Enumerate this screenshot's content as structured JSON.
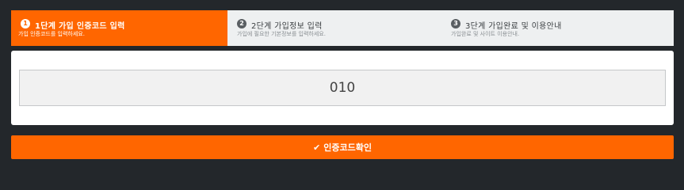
{
  "steps": [
    {
      "number": "1",
      "title": "1단계 가입 인증코드 입력",
      "subtitle": "가입 인증코드를 입력하세요.",
      "active": true
    },
    {
      "number": "2",
      "title": "2단계 가입정보 입력",
      "subtitle": "가입에 필요한 기본정보를 입력하세요.",
      "active": false
    },
    {
      "number": "3",
      "title": "3단계 가입완료 및 이용안내",
      "subtitle": "가입완료 및 사이트 이용안내.",
      "active": false
    }
  ],
  "code_input": {
    "value": "010"
  },
  "confirm_button": {
    "icon": "check-icon",
    "label": "인증코드확인"
  },
  "colors": {
    "accent": "#ff6600",
    "background": "#23272b",
    "steps_bg": "#eef0f1"
  }
}
